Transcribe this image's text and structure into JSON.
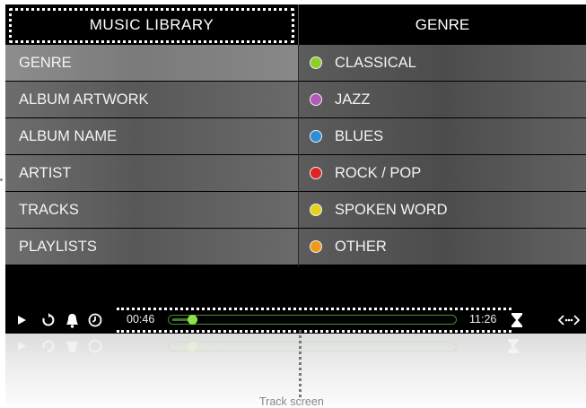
{
  "header": {
    "left_title": "MUSIC LIBRARY",
    "right_title": "GENRE"
  },
  "menu": {
    "items": [
      {
        "label": "GENRE",
        "selected": true
      },
      {
        "label": "ALBUM ARTWORK",
        "selected": false
      },
      {
        "label": "ALBUM NAME",
        "selected": false
      },
      {
        "label": "ARTIST",
        "selected": false
      },
      {
        "label": "TRACKS",
        "selected": false
      },
      {
        "label": "PLAYLISTS",
        "selected": false
      }
    ]
  },
  "genres": {
    "items": [
      {
        "label": "CLASSICAL",
        "color": "#8ccf2a"
      },
      {
        "label": "JAZZ",
        "color": "#b15ab8"
      },
      {
        "label": "BLUES",
        "color": "#2b8fd6"
      },
      {
        "label": "ROCK / POP",
        "color": "#e02424"
      },
      {
        "label": "SPOKEN WORD",
        "color": "#e6d21a"
      },
      {
        "label": "OTHER",
        "color": "#f09a1c"
      }
    ]
  },
  "transport": {
    "elapsed": "00:46",
    "total": "11:26",
    "progress_fraction": 0.07,
    "icons": [
      "play-icon",
      "repeat-icon",
      "bell-icon",
      "clock-icon",
      "hourglass-icon",
      "code-arrows-icon"
    ]
  },
  "caption": "Track screen"
}
